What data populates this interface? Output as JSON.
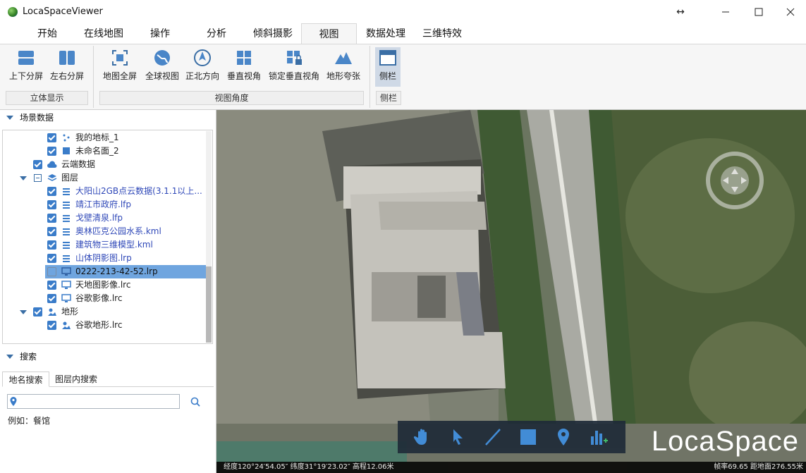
{
  "window": {
    "title": "LocaSpaceViewer",
    "restore_icon": "resize-arrows-icon"
  },
  "tabs": [
    "开始",
    "在线地图",
    "操作",
    "分析",
    "倾斜摄影",
    "视图",
    "数据处理",
    "三维特效"
  ],
  "active_tab": "视图",
  "ribbon": {
    "groups": [
      {
        "label": "立体显示",
        "buttons": [
          "上下分屏",
          "左右分屏"
        ]
      },
      {
        "label": "视图角度",
        "buttons": [
          "地图全屏",
          "全球视图",
          "正北方向",
          "垂直视角",
          "锁定垂直视角",
          "地形夸张"
        ]
      },
      {
        "label": "侧栏",
        "buttons": [
          "侧栏"
        ]
      }
    ]
  },
  "scene_panel": {
    "title": "场景数据",
    "tree": [
      {
        "label": "我的地标_1",
        "checked": true,
        "icon": "placemark-icon",
        "blue": false
      },
      {
        "label": "未命名面_2",
        "checked": true,
        "icon": "polygon-icon",
        "blue": false
      },
      {
        "label": "云端数据",
        "checked": true,
        "icon": "cloud-icon",
        "blue": false
      },
      {
        "label": "图层",
        "checked": false,
        "icon": "layers-icon",
        "blue": false
      },
      {
        "label": "大阳山2GB点云数据(3.1.1以上...",
        "checked": true,
        "icon": "layer-file-icon",
        "blue": true
      },
      {
        "label": "靖江市政府.lfp",
        "checked": true,
        "icon": "layer-file-icon",
        "blue": true
      },
      {
        "label": "戈壁清泉.lfp",
        "checked": true,
        "icon": "layer-file-icon",
        "blue": true
      },
      {
        "label": "奥林匹克公园水系.kml",
        "checked": true,
        "icon": "layer-file-icon",
        "blue": true
      },
      {
        "label": "建筑物三维模型.kml",
        "checked": true,
        "icon": "layer-file-icon",
        "blue": true
      },
      {
        "label": "山体阴影图.lrp",
        "checked": true,
        "icon": "layer-file-icon",
        "blue": true
      },
      {
        "label": "0222-213-42-52.lrp",
        "checked": false,
        "icon": "monitor-icon",
        "blue": false,
        "selected": true
      },
      {
        "label": "天地图影像.lrc",
        "checked": true,
        "icon": "monitor-icon",
        "blue": false
      },
      {
        "label": "谷歌影像.lrc",
        "checked": true,
        "icon": "monitor-icon",
        "blue": false
      },
      {
        "label": "地形",
        "checked": true,
        "icon": "terrain-icon",
        "blue": false
      },
      {
        "label": "谷歌地形.lrc",
        "checked": true,
        "icon": "terrain-icon",
        "blue": false
      }
    ]
  },
  "search_panel": {
    "title": "搜索",
    "tabs": [
      "地名搜索",
      "图层内搜索"
    ],
    "input_value": "",
    "hint": "例如：餐馆"
  },
  "map": {
    "watermark": "LocaSpace",
    "status_left": "经度120°24′54.05″ 纬度31°19′23.02″ 高程12.06米",
    "status_right": "帧率69.65 距地面276.55米",
    "tools": [
      "hand-icon",
      "select-arrow-icon",
      "line-icon",
      "rectangle-icon",
      "placemark-icon",
      "chart-add-icon"
    ]
  }
}
